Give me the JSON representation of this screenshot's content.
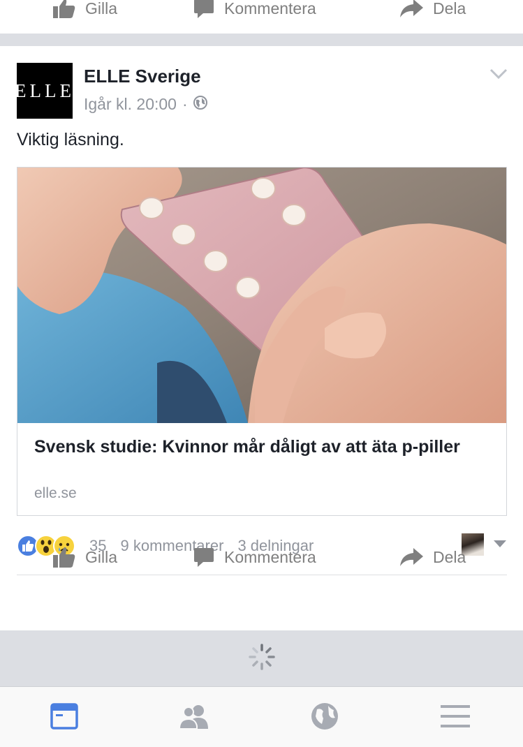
{
  "actions": {
    "like_label": "Gilla",
    "comment_label": "Kommentera",
    "share_label": "Dela"
  },
  "post": {
    "page_name": "ELLE Sverige",
    "logo_text": "ELLE",
    "timestamp": "Igår kl. 20:00",
    "separator": "·",
    "text": "Viktig läsning.",
    "link": {
      "title": "Svensk studie: Kvinnor mår dåligt av att äta p-piller",
      "domain": "elle.se"
    },
    "reactions": {
      "types": [
        "like-icon",
        "wow-icon",
        "sad-icon"
      ],
      "count": "35",
      "comments": "9 kommentarer",
      "shares": "3 delningar"
    }
  },
  "tabs": [
    "news-feed-icon",
    "friends-icon",
    "globe-icon",
    "menu-icon"
  ],
  "colors": {
    "accent": "#4267b2",
    "tab_active": "#4a7fe0",
    "tab_inactive": "#a7abb3",
    "action_gray": "#7f7f7f",
    "divider": "#dcdee3"
  }
}
